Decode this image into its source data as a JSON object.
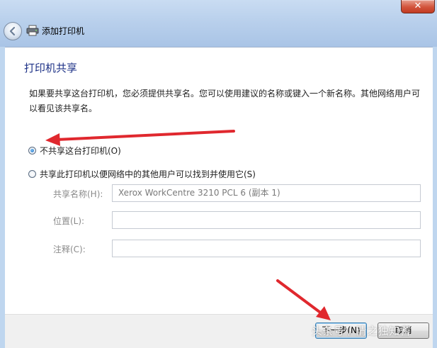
{
  "window": {
    "title": "添加打印机",
    "close_label": "✕"
  },
  "heading": "打印机共享",
  "description": "如果要共享这台打印机，您必须提供共享名。您可以使用建议的名称或键入一个新名称。其他网络用户可以看见该共享名。",
  "options": {
    "no_share": {
      "label": "不共享这台打印机(O)",
      "checked": true
    },
    "share": {
      "label": "共享此打印机以便网络中的其他用户可以找到并使用它(S)",
      "checked": false
    }
  },
  "fields": {
    "share_name": {
      "label": "共享名称(H):",
      "value": "Xerox WorkCentre 3210 PCL 6 (副本 1)"
    },
    "location": {
      "label": "位置(L):",
      "value": ""
    },
    "comment": {
      "label": "注释(C):",
      "value": ""
    }
  },
  "buttons": {
    "next": "下一步(N)",
    "cancel": "取消"
  },
  "watermark": "头条号 / 清之独知耆",
  "colors": {
    "annotation_arrow": "#e0282e",
    "heading": "#1e3287"
  }
}
